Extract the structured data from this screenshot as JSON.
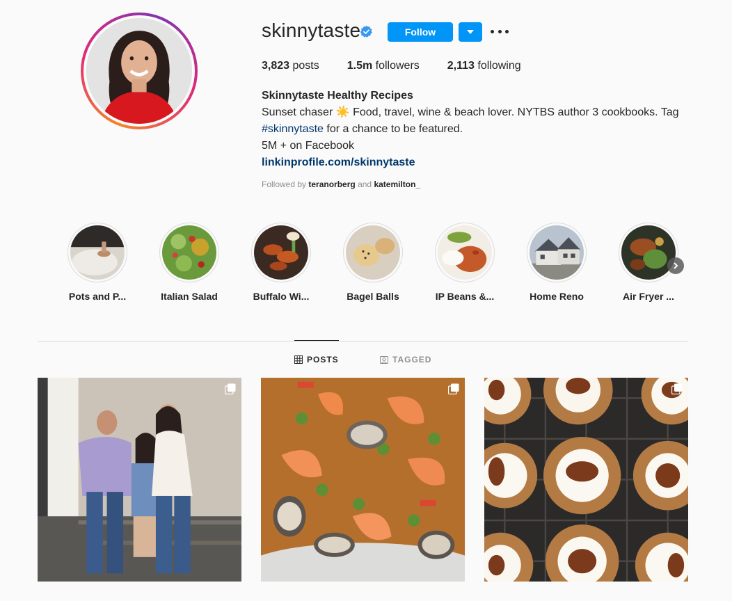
{
  "profile": {
    "username": "skinnytaste",
    "verified": true,
    "follow_label": "Follow",
    "more_icon": "more-horizontal-icon",
    "stats": {
      "posts_count": "3,823",
      "posts_label": " posts",
      "followers_count": "1.5m",
      "followers_label": " followers",
      "following_count": "2,113",
      "following_label": " following"
    },
    "bio": {
      "name": "Skinnytaste Healthy Recipes",
      "line1": "Sunset chaser ☀️  Food, travel, wine & beach lover. NYTBS author 3 cookbooks. Tag",
      "hashtag": "#skinnytaste",
      "line2_rest": " for a chance to be featured.",
      "line3": "5M + on Facebook",
      "link": "linkinprofile.com/skinnytaste"
    },
    "followed_by": {
      "prefix": "Followed by ",
      "user1": "teranorberg",
      "joiner": " and ",
      "user2": "katemilton_"
    }
  },
  "highlights": [
    {
      "label": "Pots and P..."
    },
    {
      "label": "Italian Salad"
    },
    {
      "label": "Buffalo Wi..."
    },
    {
      "label": "Bagel Balls"
    },
    {
      "label": "IP Beans &..."
    },
    {
      "label": "Home Reno"
    },
    {
      "label": "Air Fryer ..."
    }
  ],
  "tabs": {
    "posts": "POSTS",
    "tagged": "TAGGED"
  },
  "colors": {
    "primary_button": "#0095f6",
    "link": "#00376b",
    "text": "#262626",
    "muted": "#8e8e8e",
    "border": "#dbdbdb",
    "background": "#fafafa"
  }
}
